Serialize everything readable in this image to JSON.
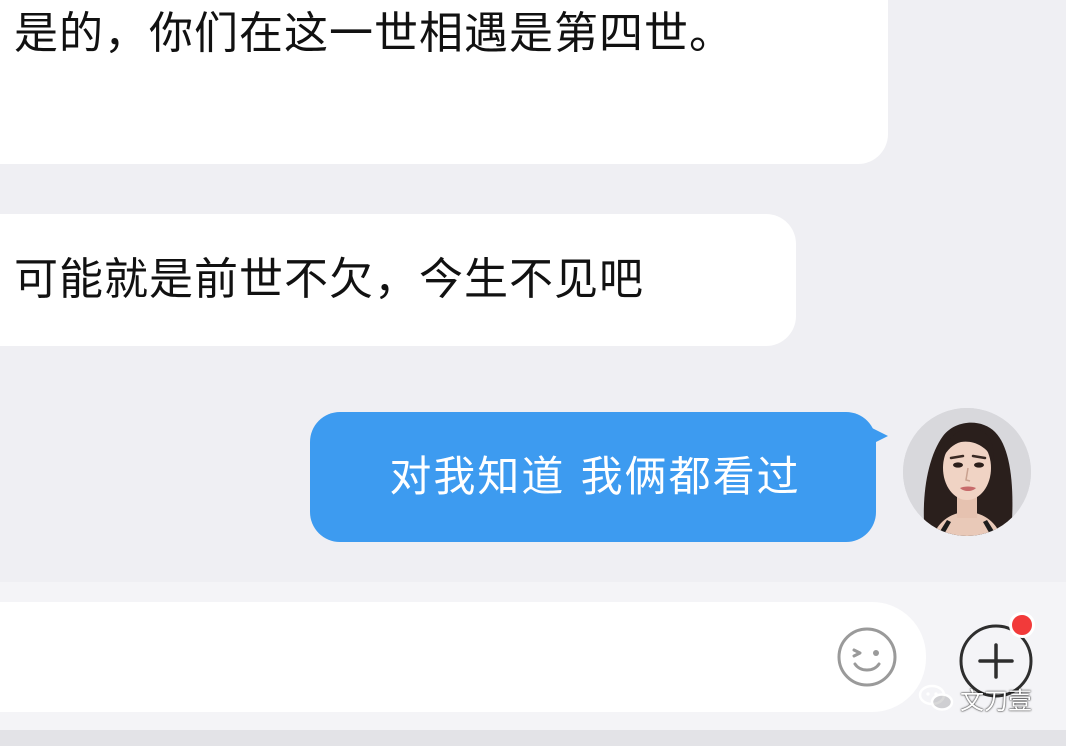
{
  "messages": [
    {
      "direction": "incoming",
      "text": "是的，你们在这一世相遇是第四世。"
    },
    {
      "direction": "incoming",
      "text": "可能就是前世不欠，今生不见吧"
    },
    {
      "direction": "outgoing",
      "text": "对我知道 我俩都看过"
    }
  ],
  "input": {
    "value": "",
    "placeholder": ""
  },
  "icons": {
    "emoji": "emoji-smiley-icon",
    "plus": "plus-circle-icon",
    "notification_dot": "red-dot-badge",
    "watermark_logo": "wechat-logo-icon"
  },
  "watermark": {
    "text": "文刀壹"
  },
  "colors": {
    "chat_background": "#efeff3",
    "incoming_bubble": "#ffffff",
    "outgoing_bubble": "#3d9bf0",
    "badge": "#f23a3a"
  }
}
